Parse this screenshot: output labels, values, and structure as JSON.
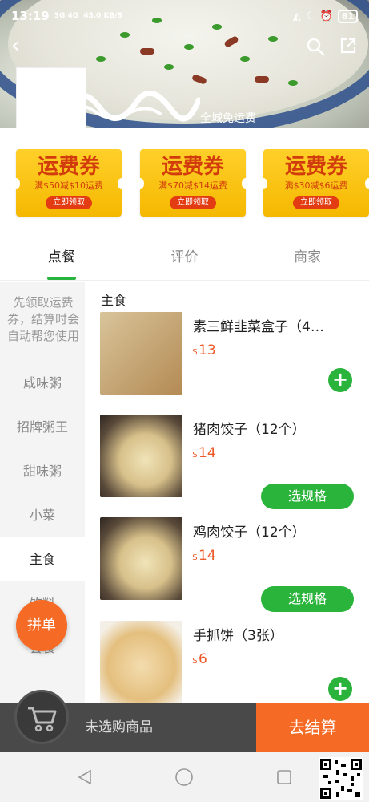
{
  "status_bar": {
    "time": "13:19",
    "signal_text": "3G 4G",
    "net_speed": "45.0 KB/S",
    "battery": "81"
  },
  "header": {
    "store_notice": "全城免运费"
  },
  "coupons": [
    {
      "title": "运费券",
      "desc": "满$50减$10运费",
      "button": "立即领取"
    },
    {
      "title": "运费券",
      "desc": "满$70减$14运费",
      "button": "立即领取"
    },
    {
      "title": "运费券",
      "desc": "满$30减$6运费",
      "button": "立即领取"
    }
  ],
  "tabs": [
    {
      "label": "点餐",
      "active": true
    },
    {
      "label": "评价",
      "active": false
    },
    {
      "label": "商家",
      "active": false
    }
  ],
  "sidebar": {
    "note": "先领取运费券，结算时会自动帮您使用",
    "items": [
      {
        "label": "咸味粥"
      },
      {
        "label": "招牌粥王"
      },
      {
        "label": "甜味粥"
      },
      {
        "label": "小菜"
      },
      {
        "label": "主食",
        "active": true
      },
      {
        "label": "饮料"
      },
      {
        "label": "套餐"
      }
    ]
  },
  "group_button": "拼单",
  "section_title": "主食",
  "products": [
    {
      "name": "素三鲜韭菜盒子（4…",
      "currency": "$",
      "price": "13",
      "action": "+"
    },
    {
      "name": "猪肉饺子（12个）",
      "currency": "$",
      "price": "14",
      "action": "选规格"
    },
    {
      "name": "鸡肉饺子（12个）",
      "currency": "$",
      "price": "14",
      "action": "选规格"
    },
    {
      "name": "手抓饼（3张）",
      "currency": "$",
      "price": "6",
      "action": "+"
    }
  ],
  "cart": {
    "empty_text": "未选购商品",
    "checkout_label": "去结算"
  },
  "colors": {
    "accent_green": "#2bb43c",
    "accent_orange": "#f56a24",
    "price_red": "#ec5a29",
    "coupon_yellow": "#f5b800"
  }
}
